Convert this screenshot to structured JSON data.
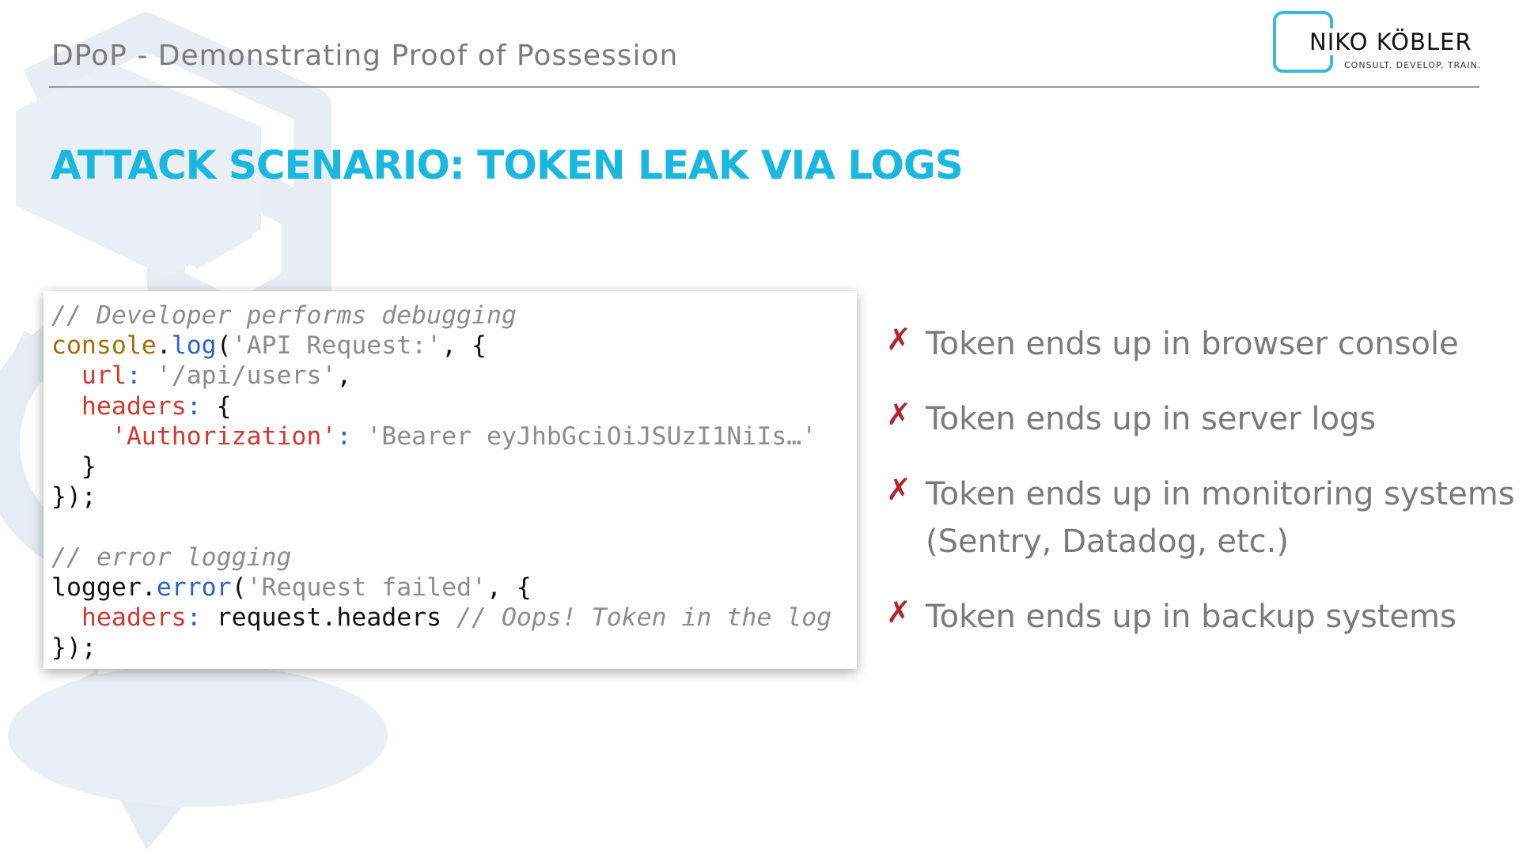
{
  "header": {
    "title": "DPoP - Demonstrating Proof of Possession"
  },
  "logo": {
    "name": "NIKO KÖBLER",
    "tagline": "CONSULT. DEVELOP. TRAIN."
  },
  "slide": {
    "heading": "ATTACK SCENARIO: TOKEN LEAK VIA LOGS"
  },
  "code": {
    "line1": "// Developer performs debugging",
    "line2_obj": "console",
    "line2_dot": ".",
    "line2_fn": "log",
    "line2_open": "(",
    "line2_str": "'API Request:'",
    "line2_rest": ", {",
    "line3_key": "  url",
    "line3_colon": ":",
    "line3_str": " '/api/users'",
    "line3_rest": ",",
    "line4_key": "  headers",
    "line4_colon": ":",
    "line4_rest": " {",
    "line5_key": "    'Authorization'",
    "line5_colon": ":",
    "line5_str": " 'Bearer eyJhbGciOiJSUzI1NiIs…'",
    "line6": "  }",
    "line7": "});",
    "line8": "",
    "line9": "// error logging",
    "line10_obj": "logger",
    "line10_dot": ".",
    "line10_fn": "error",
    "line10_open": "(",
    "line10_str": "'Request failed'",
    "line10_rest": ", {",
    "line11_key": "  headers",
    "line11_colon": ":",
    "line11_plain": " request.headers ",
    "line11_comment": "// Oops! Token in the log",
    "line12": "});"
  },
  "bullets": {
    "mark": "✗",
    "items": [
      {
        "text": "Token ends up in browser console"
      },
      {
        "text": "Token ends up in server logs"
      },
      {
        "text": "Token ends up in monitoring systems",
        "text2": "(Sentry, Datadog, etc.)"
      },
      {
        "text": "Token ends up in backup systems"
      }
    ]
  },
  "colors": {
    "accent": "#1ab8e0",
    "bullet_mark": "#b3262e",
    "text_gray": "#7a7a7a",
    "logo_border": "#3bb8dd"
  }
}
